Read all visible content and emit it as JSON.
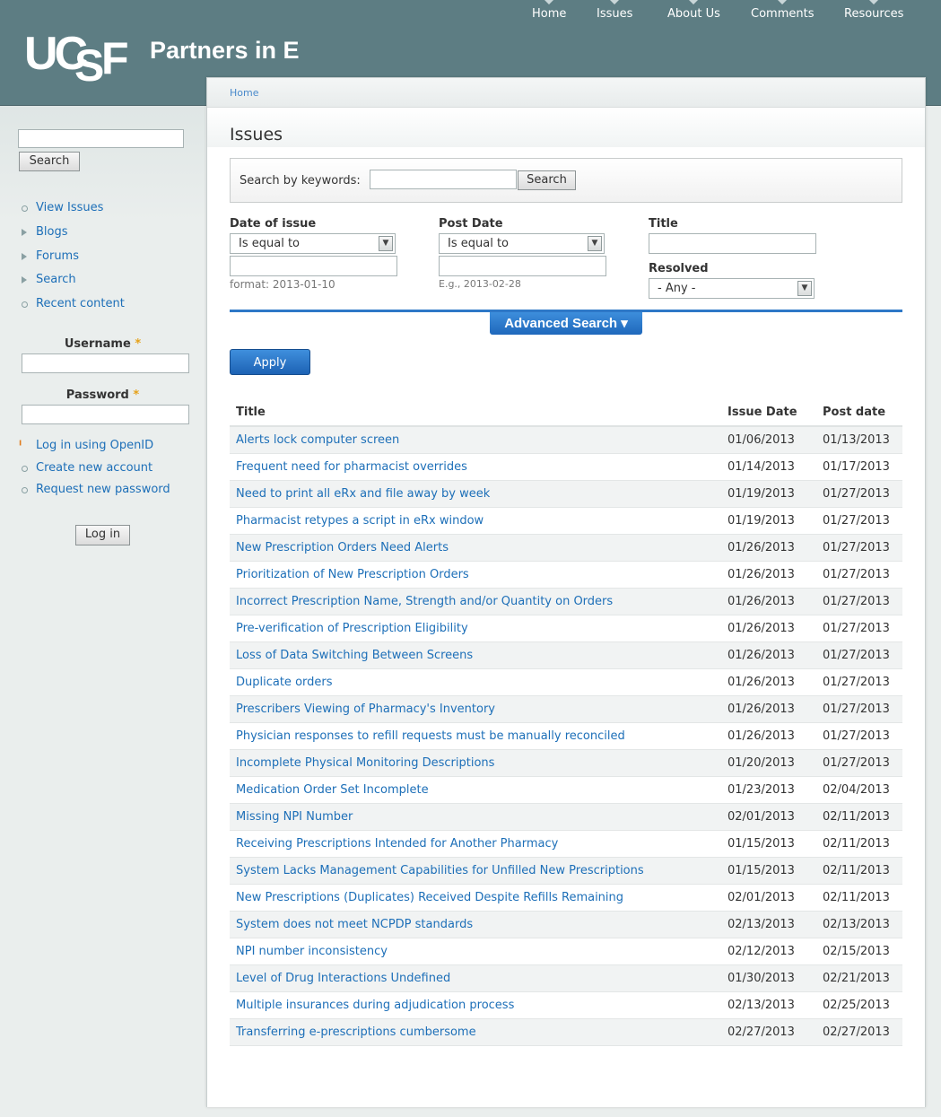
{
  "header": {
    "logo_text": "UCSF",
    "site_name": "Partners in E",
    "nav": [
      "Home",
      "Issues",
      "About Us",
      "Comments",
      "Resources"
    ]
  },
  "sidebar": {
    "search_button": "Search",
    "nav": [
      {
        "label": "View Issues",
        "bullet": "circle"
      },
      {
        "label": "Blogs",
        "bullet": "triangle"
      },
      {
        "label": "Forums",
        "bullet": "triangle"
      },
      {
        "label": "Search",
        "bullet": "triangle"
      },
      {
        "label": "Recent content",
        "bullet": "circle"
      }
    ],
    "login": {
      "username_label": "Username",
      "password_label": "Password",
      "required_mark": "*",
      "links": [
        "Log in using OpenID",
        "Create new account",
        "Request new password"
      ],
      "login_button": "Log in"
    }
  },
  "content": {
    "breadcrumb": "Home",
    "page_title": "Issues",
    "keyword_label": "Search by keywords:",
    "keyword_button": "Search",
    "filters": {
      "date_of_issue": {
        "label": "Date of issue",
        "operator": "Is equal to",
        "hint": "format: 2013-01-10"
      },
      "post_date": {
        "label": "Post Date",
        "operator": "Is equal to",
        "hint": "E.g., 2013-02-28"
      },
      "title": {
        "label": "Title"
      },
      "resolved": {
        "label": "Resolved",
        "value": "- Any -"
      }
    },
    "advanced_search": "Advanced Search ▾",
    "apply_button": "Apply",
    "table": {
      "headers": [
        "Title",
        "Issue Date",
        "Post date"
      ],
      "rows": [
        [
          "Alerts lock computer screen",
          "01/06/2013",
          "01/13/2013"
        ],
        [
          "Frequent need for pharmacist overrides",
          "01/14/2013",
          "01/17/2013"
        ],
        [
          "Need to print all eRx and file away by week",
          "01/19/2013",
          "01/27/2013"
        ],
        [
          "Pharmacist retypes a script in eRx window",
          "01/19/2013",
          "01/27/2013"
        ],
        [
          "New Prescription Orders Need Alerts",
          "01/26/2013",
          "01/27/2013"
        ],
        [
          "Prioritization of New Prescription Orders",
          "01/26/2013",
          "01/27/2013"
        ],
        [
          "Incorrect Prescription Name, Strength and/or Quantity on Orders",
          "01/26/2013",
          "01/27/2013"
        ],
        [
          "Pre-verification of Prescription Eligibility",
          "01/26/2013",
          "01/27/2013"
        ],
        [
          "Loss of Data Switching Between Screens",
          "01/26/2013",
          "01/27/2013"
        ],
        [
          "Duplicate orders",
          "01/26/2013",
          "01/27/2013"
        ],
        [
          "Prescribers Viewing of Pharmacy's Inventory",
          "01/26/2013",
          "01/27/2013"
        ],
        [
          "Physician responses to refill requests must be manually reconciled",
          "01/26/2013",
          "01/27/2013"
        ],
        [
          "Incomplete Physical Monitoring Descriptions",
          "01/20/2013",
          "01/27/2013"
        ],
        [
          "Medication Order Set Incomplete",
          "01/23/2013",
          "02/04/2013"
        ],
        [
          "Missing NPI Number",
          "02/01/2013",
          "02/11/2013"
        ],
        [
          "Receiving Prescriptions Intended for Another Pharmacy",
          "01/15/2013",
          "02/11/2013"
        ],
        [
          "System Lacks Management Capabilities for Unfilled New Prescriptions",
          "01/15/2013",
          "02/11/2013"
        ],
        [
          "New Prescriptions (Duplicates) Received Despite Refills Remaining",
          "02/01/2013",
          "02/11/2013"
        ],
        [
          "System does not meet NCPDP standards",
          "02/13/2013",
          "02/13/2013"
        ],
        [
          "NPI number inconsistency",
          "02/12/2013",
          "02/15/2013"
        ],
        [
          "Level of Drug Interactions Undefined",
          "01/30/2013",
          "02/21/2013"
        ],
        [
          "Multiple insurances during adjudication process",
          "02/13/2013",
          "02/25/2013"
        ],
        [
          "Transferring e-prescriptions cumbersome",
          "02/27/2013",
          "02/27/2013"
        ]
      ]
    }
  },
  "colors": {
    "header_bg": "#5d7d83",
    "link": "#1d6fb8",
    "accent_blue": "#2e78c7"
  }
}
